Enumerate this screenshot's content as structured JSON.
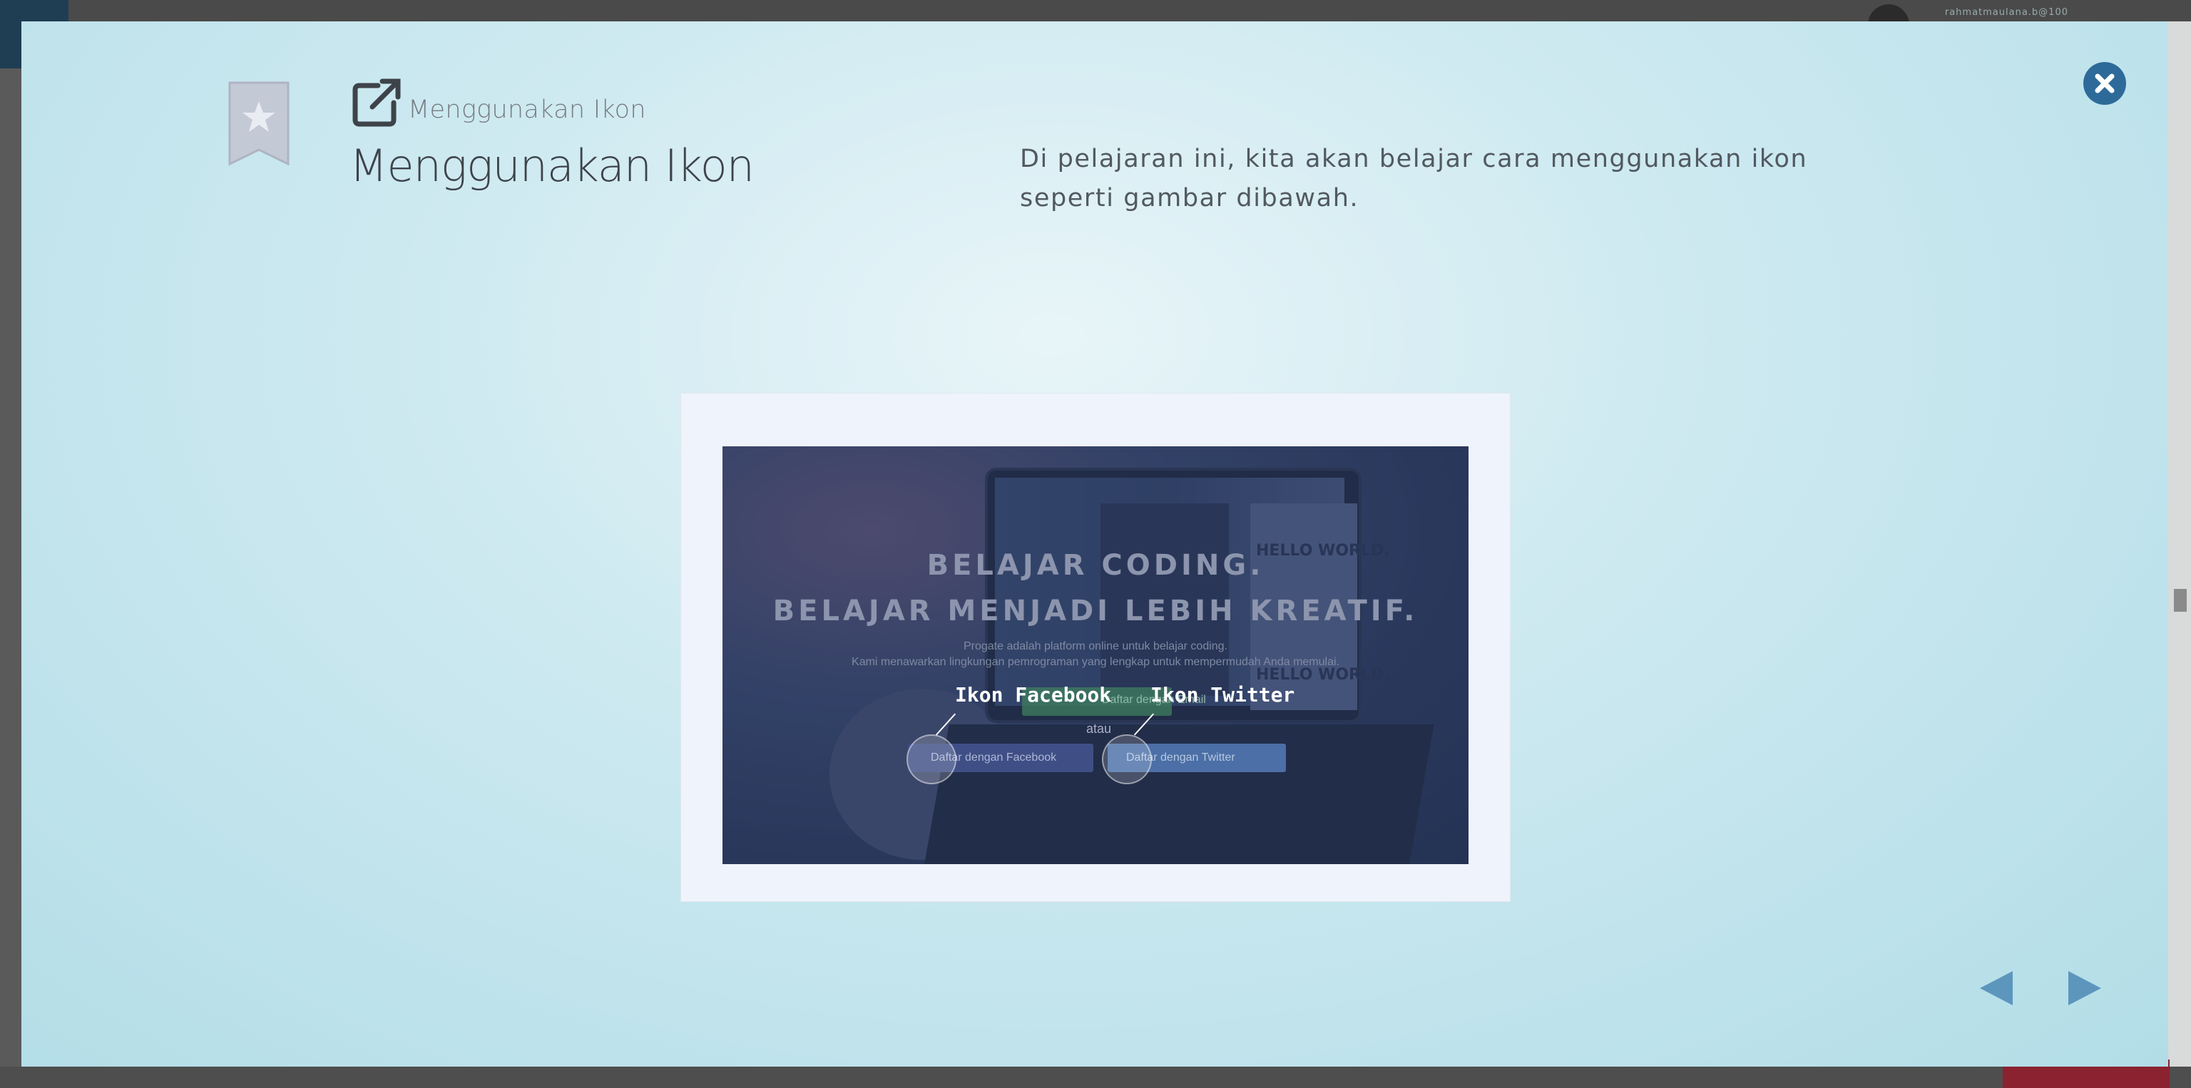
{
  "background": {
    "username": "rahmatmaulana.b@100"
  },
  "lesson": {
    "breadcrumb": "Menggunakan Ikon",
    "title": "Menggunakan Ikon",
    "description": "Di pelajaran ini, kita akan belajar cara menggunakan ikon seperti gambar dibawah."
  },
  "screenshot": {
    "headline_1": "BELAJAR CODING.",
    "headline_2": "BELAJAR MENJADI LEBIH KREATIF.",
    "subtext_1": "Progate adalah platform online untuk belajar coding.",
    "subtext_2": "Kami menawarkan lingkungan pemrograman yang lengkap untuk mempermudah Anda memulai.",
    "email_button": "Daftar dengan Email",
    "or_text": "atau",
    "facebook_button": "Daftar dengan Facebook",
    "twitter_button": "Daftar dengan Twitter",
    "callout_facebook": "Ikon Facebook",
    "callout_twitter": "Ikon Twitter",
    "screen_text_1": "HELLO WORLD.",
    "screen_text_2": "HELLO WORLD."
  },
  "icons": {
    "bookmark": "star-bookmark-icon",
    "external": "external-link-icon",
    "close": "close-circle-icon",
    "prev": "triangle-left-icon",
    "next": "triangle-right-icon"
  },
  "colors": {
    "accent": "#2e6a99",
    "nav_arrow": "#5d96bd",
    "bookmark": "#c4c9d6"
  }
}
